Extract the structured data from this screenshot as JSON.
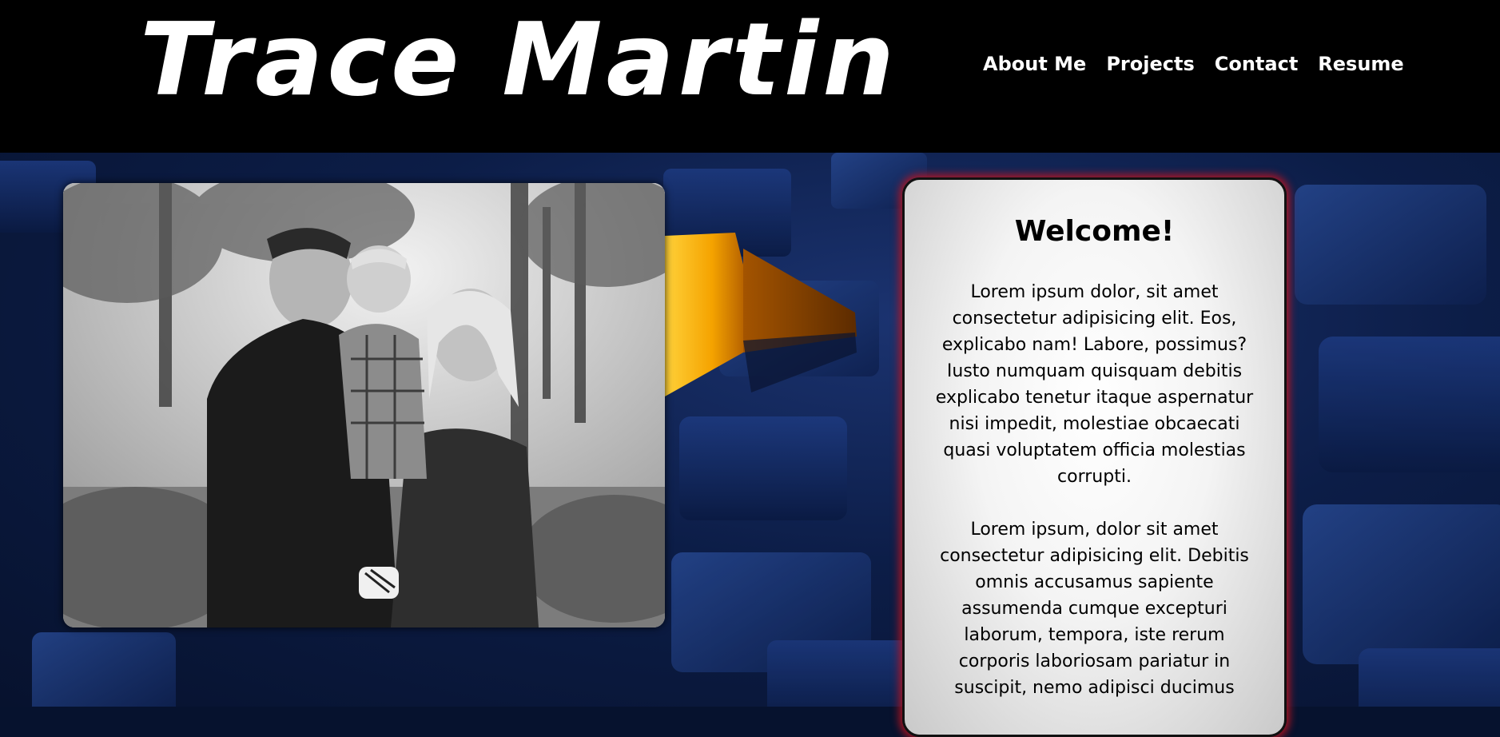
{
  "header": {
    "title": "Trace Martin",
    "nav": [
      "About Me",
      "Projects",
      "Contact",
      "Resume"
    ]
  },
  "hero": {
    "photo_alt": "Family photo"
  },
  "welcome": {
    "heading": "Welcome!",
    "paragraph1": "Lorem ipsum dolor, sit amet consectetur adipisicing elit. Eos, explicabo nam! Labore, possimus? Iusto numquam quisquam debitis explicabo tenetur itaque aspernatur nisi impedit, molestiae obcaecati quasi voluptatem officia molestias corrupti.",
    "paragraph2": "Lorem ipsum, dolor sit amet consectetur adipisicing elit. Debitis omnis accusamus sapiente assumenda cumque excepturi laborum, tempora, iste rerum corporis laboriosam pariatur in suscipit, nemo adipisci ducimus"
  },
  "colors": {
    "header_bg": "#000000",
    "page_bg": "#0c1d47",
    "accent_orange": "#f5a300",
    "card_glow": "#be141e"
  }
}
